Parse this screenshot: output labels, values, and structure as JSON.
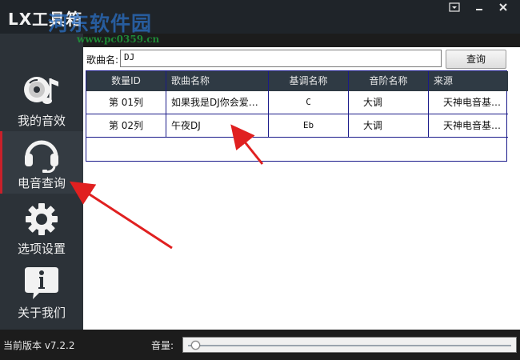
{
  "window": {
    "app_title": "LX工具箱",
    "watermark": "河东软件园",
    "watermark_url": "www.pc0359.cn",
    "menu_icon": "menu-icon",
    "minimize_icon": "minimize-icon",
    "close_icon": "close-icon"
  },
  "sidebar": {
    "items": [
      {
        "label": "我的音效",
        "icon": "music-disc-icon"
      },
      {
        "label": "电音查询",
        "icon": "headphones-icon",
        "active": true
      },
      {
        "label": "选项设置",
        "icon": "gear-icon"
      },
      {
        "label": "关于我们",
        "icon": "info-icon"
      }
    ]
  },
  "search": {
    "label": "歌曲名:",
    "value": "DJ",
    "button": "查询"
  },
  "table": {
    "headers": [
      "数量ID",
      "歌曲名称",
      "基调名称",
      "音阶名称",
      "来源"
    ],
    "rows": [
      [
        "第 01列",
        "如果我是DJ你会爱…",
        "C",
        "大调",
        "天神电音基…"
      ],
      [
        "第 02列",
        "午夜DJ",
        "Eb",
        "大调",
        "天神电音基…"
      ]
    ]
  },
  "status": {
    "version": "当前版本 v7.2.2",
    "volume_label": "音量:",
    "volume_level": 0.02
  },
  "colors": {
    "accent_active": "#c8202a",
    "annotation_arrow": "#e02020",
    "table_border": "#1a1a8a"
  }
}
